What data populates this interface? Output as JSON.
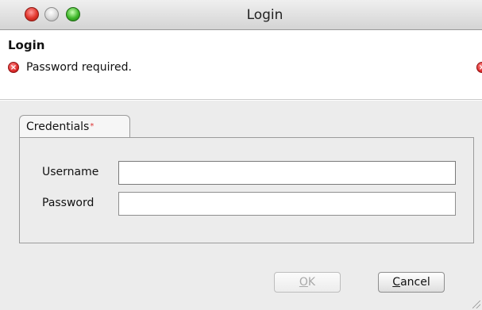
{
  "window": {
    "title": "Login"
  },
  "header": {
    "title": "Login",
    "error_message": "Password required.",
    "error_icon": "error-x-icon"
  },
  "tabs": [
    {
      "label": "Credentials",
      "invalid_marker": "*",
      "selected": true
    }
  ],
  "form": {
    "username_label": "Username",
    "username_value": "",
    "password_label": "Password",
    "password_value": ""
  },
  "buttons": {
    "ok_label": "OK",
    "ok_mnemonic": "O",
    "ok_rest": "K",
    "ok_enabled": false,
    "cancel_label": "Cancel",
    "cancel_mnemonic": "C",
    "cancel_rest": "ancel"
  },
  "colors": {
    "error": "#dd2a2a",
    "close_button": "#e0342a",
    "zoom_button": "#3fb72a"
  }
}
